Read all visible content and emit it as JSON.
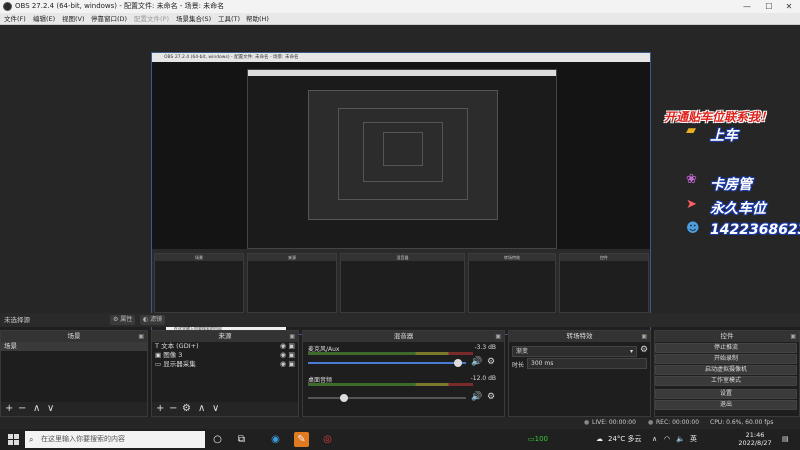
{
  "window": {
    "title": "OBS 27.2.4 (64-bit, windows) - 配置文件: 未命名 - 场景: 未命名",
    "minimize": "—",
    "maximize": "☐",
    "close": "✕"
  },
  "menu": {
    "items": [
      "文件(F)",
      "编辑(E)",
      "视图(V)",
      "停靠窗口(D)",
      "配置文件(P)",
      "场景集合(S)",
      "工具(T)",
      "帮助(H)"
    ]
  },
  "preview": {
    "nested_title": "OBS 27.2.4 (64-bit, windows) - 配置文件: 未命名 - 场景: 未命名",
    "nested_search": "在这里输入你要搜索的内容",
    "overlay": {
      "title": "开通贴车位联系我！",
      "lines": [
        "上车",
        "卡房管",
        "永久车位",
        "1422368623"
      ]
    }
  },
  "scene_bar": {
    "label": "未选择源",
    "properties": "属性",
    "filters": "滤镜"
  },
  "scenes": {
    "header": "场景",
    "items": [
      "场景"
    ],
    "footer": [
      "+",
      "−",
      "∧",
      "∨"
    ]
  },
  "sources": {
    "header": "来源",
    "items": [
      {
        "icon": "T",
        "label": "文本 (GDI+)"
      },
      {
        "icon": "▣",
        "label": "图像 3"
      },
      {
        "icon": "▭",
        "label": "显示器采集"
      }
    ],
    "footer": [
      "+",
      "−",
      "⚙",
      "∧",
      "∨"
    ]
  },
  "mixer": {
    "header": "混音器",
    "tracks": [
      {
        "name": "麦克风/Aux",
        "db": "-3.3 dB",
        "volume": 0.97
      },
      {
        "name": "桌面音频",
        "db": "-12.0 dB",
        "volume": 0.21
      }
    ],
    "scale": [
      "-60",
      "-55",
      "-50",
      "-45",
      "-40",
      "-35",
      "-30",
      "-25",
      "-20",
      "-15",
      "-10",
      "-5",
      "0"
    ]
  },
  "transitions": {
    "header": "转场特效",
    "selected": "渐变",
    "duration_label": "时长",
    "duration_value": "300 ms"
  },
  "controls": {
    "header": "控件",
    "buttons": [
      "停止推流",
      "开始录制",
      "启动虚拟摄像机",
      "工作室模式",
      "设置",
      "退出"
    ]
  },
  "status": {
    "live": "LIVE: 00:00:00",
    "rec": "REC: 00:00:00",
    "cpu": "CPU: 0.6%, 60.00 fps"
  },
  "taskbar": {
    "search_placeholder": "在这里输入你要搜索的内容",
    "weather": "24°C 多云",
    "time": "21:46",
    "date": "2022/8/27",
    "battery": "100"
  },
  "colors": {
    "promo_red": "#e0201a",
    "meter_green": "#3e6a2a",
    "slider_blue": "#4a7bd0"
  }
}
